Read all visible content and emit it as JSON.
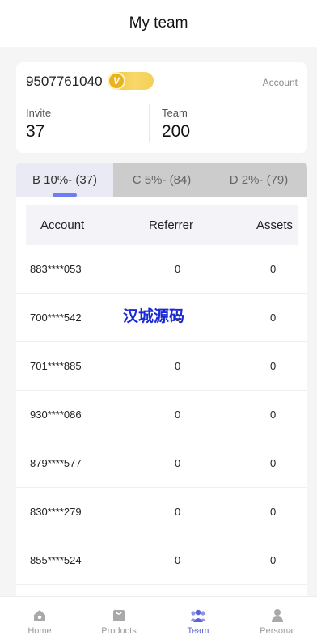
{
  "header": {
    "title": "My team"
  },
  "account": {
    "number": "9507761040",
    "badge_mark": "V",
    "link_label": "Account",
    "invite_label": "Invite",
    "invite_value": "37",
    "team_label": "Team",
    "team_value": "200"
  },
  "tabs": [
    {
      "label": "B 10%- (37)"
    },
    {
      "label": "C 5%- (84)"
    },
    {
      "label": "D 2%- (79)"
    }
  ],
  "table": {
    "headers": [
      "Account",
      "Referrer",
      "Assets"
    ],
    "rows": [
      [
        "883****053",
        "0",
        "0"
      ],
      [
        "700****542",
        "0",
        "0"
      ],
      [
        "701****885",
        "0",
        "0"
      ],
      [
        "930****086",
        "0",
        "0"
      ],
      [
        "879****577",
        "0",
        "0"
      ],
      [
        "830****279",
        "0",
        "0"
      ],
      [
        "855****524",
        "0",
        "0"
      ]
    ]
  },
  "watermark": "汉城源码",
  "tabbar": [
    {
      "label": "Home",
      "icon": "home-icon"
    },
    {
      "label": "Products",
      "icon": "products-icon"
    },
    {
      "label": "Team",
      "icon": "team-icon"
    },
    {
      "label": "Personal",
      "icon": "person-icon"
    }
  ],
  "colors": {
    "accent": "#5a63d8",
    "badge_gold": "#f4c73b",
    "watermark_blue": "#1a2ad8"
  }
}
